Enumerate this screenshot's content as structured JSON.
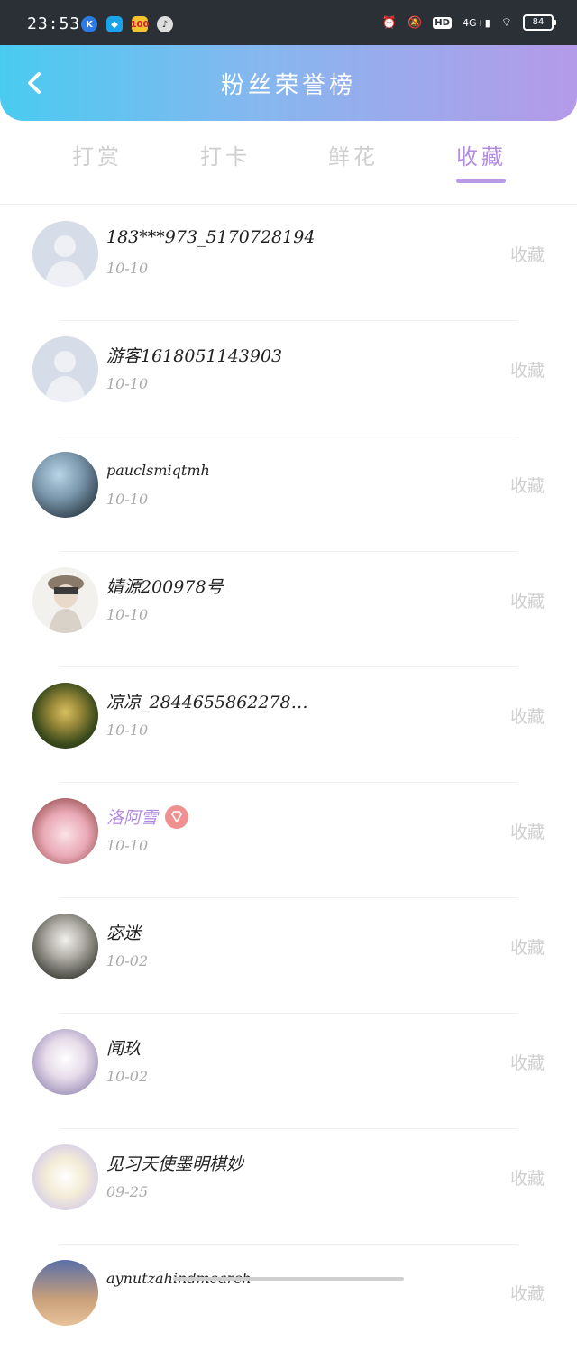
{
  "status_bar": {
    "time": "23:53",
    "network": "4G+",
    "hd": "HD",
    "battery": "84"
  },
  "header": {
    "title": "粉丝荣誉榜"
  },
  "tabs": [
    {
      "label": "打赏",
      "active": false
    },
    {
      "label": "打卡",
      "active": false
    },
    {
      "label": "鲜花",
      "active": false
    },
    {
      "label": "收藏",
      "active": true
    }
  ],
  "colors": {
    "header_start": "#49cbf0",
    "header_end": "#b59ae9",
    "accent": "#b18be0"
  },
  "fans": [
    {
      "name": "183***973_5170728194",
      "date": "10-10",
      "action": "收藏"
    },
    {
      "name": "游客1618051143903",
      "date": "10-10",
      "action": "收藏"
    },
    {
      "name": "pauclsmiqtmh",
      "date": "10-10",
      "action": "收藏"
    },
    {
      "name": "婧源200978号",
      "date": "10-10",
      "action": "收藏"
    },
    {
      "name": "凉凉_2844655862278…",
      "date": "10-10",
      "action": "收藏"
    },
    {
      "name": "洛阿雪",
      "date": "10-10",
      "action": "收藏",
      "vip": true
    },
    {
      "name": "宓迷",
      "date": "10-02",
      "action": "收藏"
    },
    {
      "name": "闻玖",
      "date": "10-02",
      "action": "收藏"
    },
    {
      "name": "见习天使墨明棋妙",
      "date": "09-25",
      "action": "收藏"
    },
    {
      "name": "aynutzahindmearch",
      "date": "",
      "action": "收藏"
    }
  ]
}
